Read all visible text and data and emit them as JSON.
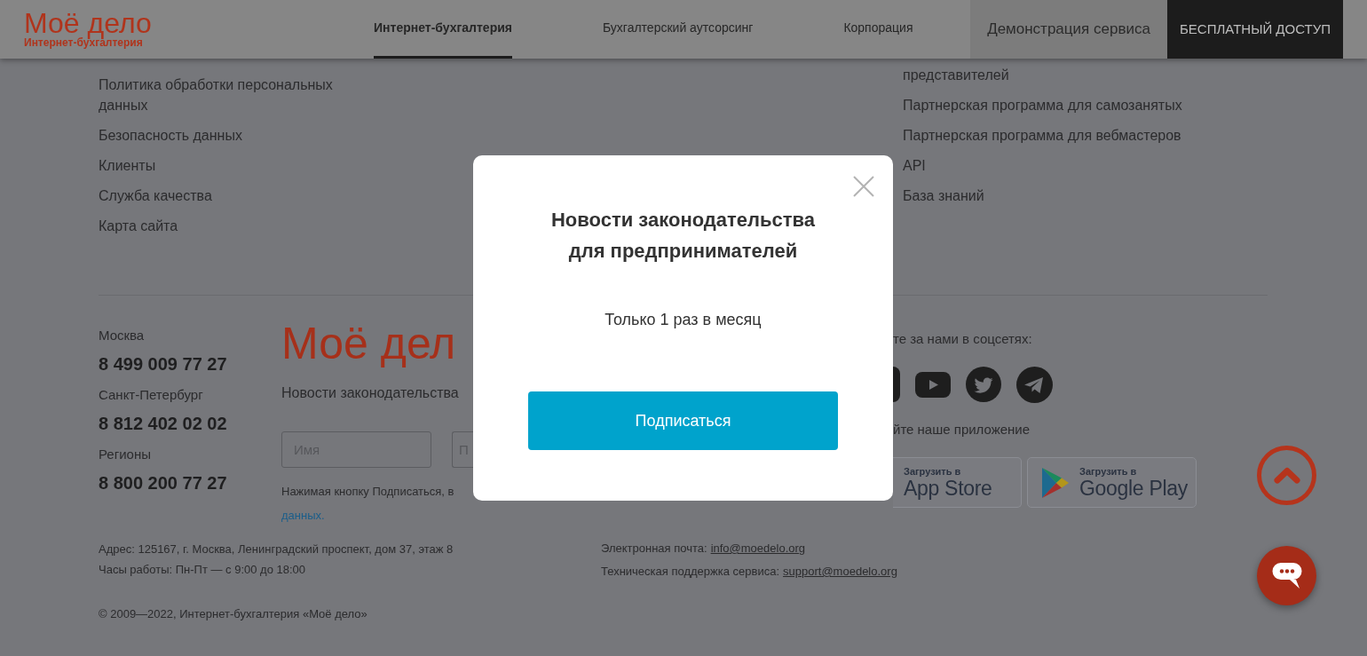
{
  "header": {
    "logo": {
      "name": "Моё дело",
      "tagline": "Интернет-бухгалтерия"
    },
    "nav": [
      {
        "label": "Интернет-бухгалтерия",
        "selected": true
      },
      {
        "label": "Бухгалтерский аутсорсинг",
        "selected": false
      },
      {
        "label": "Корпорация",
        "selected": false
      }
    ],
    "demo_link": "Демонстрация сервиса",
    "cta_button": "БЕСПЛАТНЫЙ ДОСТУП"
  },
  "link_columns": [
    {
      "links": [
        "Политика обработки персональных данных",
        "Безопасность данных",
        "Клиенты",
        "Служба качества",
        "Карта сайта"
      ]
    },
    {
      "links": [
        "представителей",
        "Партнерская программа для самозанятых",
        "Партнерская программа для вебмастеров",
        "API",
        "База знаний"
      ]
    }
  ],
  "contacts": [
    {
      "city": "Москва",
      "phone": "8 499 009 77 27"
    },
    {
      "city": "Санкт-Петербург",
      "phone": "8 812 402 02 02"
    },
    {
      "city": "Регионы",
      "phone": "8 800 200 77 27"
    }
  ],
  "subscribe_form": {
    "logo": "Моё дел",
    "title": "Новости законодательства",
    "fields": [
      {
        "placeholder": "Имя"
      },
      {
        "placeholder": "П"
      }
    ],
    "consent": "Нажимая кнопку Подписаться, в",
    "consent_link": "данных."
  },
  "social": {
    "caption": "те за нами в соцсетях:"
  },
  "apps": {
    "caption": "йте наше приложение",
    "buttons": [
      {
        "kind": "app_store",
        "caption": "Загрузить в",
        "store": "App Store"
      },
      {
        "kind": "google_play",
        "caption": "Загрузить в",
        "store": "Google Play"
      }
    ]
  },
  "address": [
    "Адрес: 125167, г. Москва, Ленинградский проспект, дом 37, этаж 8",
    "Часы работы: Пн-Пт — с 9:00 до 18:00"
  ],
  "emails": [
    {
      "label": "Электронная почта:",
      "address": "info@moedelo.org"
    },
    {
      "label": "Техническая поддержка сервиса:",
      "address": "support@moedelo.org"
    }
  ],
  "copyright": "© 2009—2022, Интернет-бухгалтерия «Моё дело»",
  "modal": {
    "title": "Новости законодательства для предпринимателей",
    "subtitle": "Только 1 раз в месяц",
    "button": "Подписаться"
  }
}
